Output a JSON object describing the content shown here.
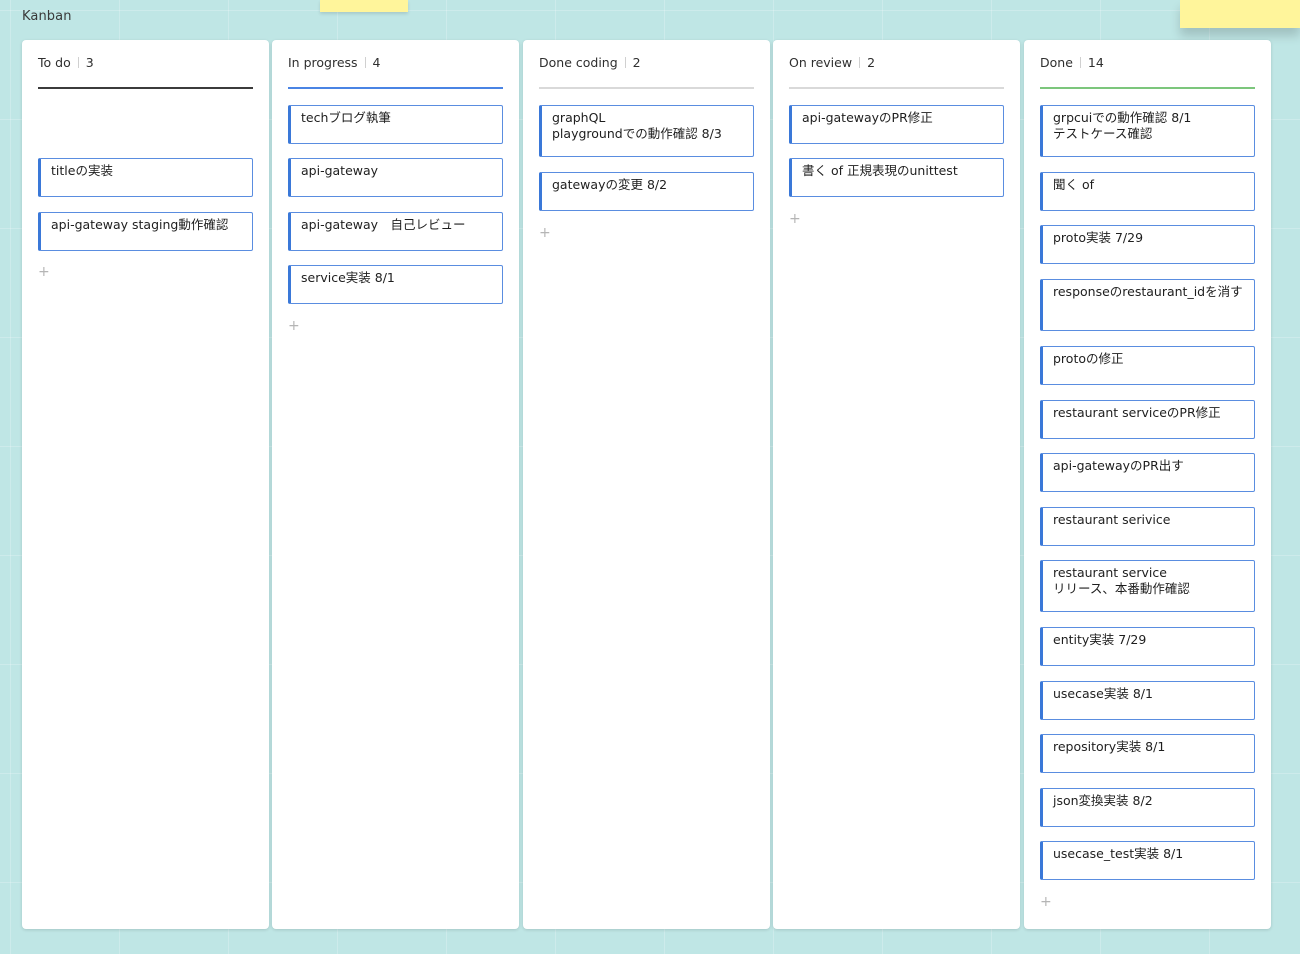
{
  "board": {
    "title": "Kanban"
  },
  "colors": {
    "background": "#bfe6e5",
    "card_border": "#3a78d8",
    "sticky_note": "#fff59b"
  },
  "columns": [
    {
      "title": "To do",
      "count": "3",
      "rule_color": "#3b3b3b",
      "cards": [
        "titleの実装",
        "api-gateway staging動作確認"
      ]
    },
    {
      "title": "In progress",
      "count": "4",
      "rule_color": "#4a84e4",
      "cards": [
        "techブログ執筆",
        "api-gateway",
        "api-gateway　自己レビュー",
        "service実装 8/1"
      ]
    },
    {
      "title": "Done coding",
      "count": "2",
      "rule_color": "#d9d9d9",
      "cards": [
        "graphQL\nplaygroundでの動作確認 8/3",
        "gatewayの変更 8/2"
      ]
    },
    {
      "title": "On review",
      "count": "2",
      "rule_color": "#d9d9d9",
      "cards": [
        "api-gatewayのPR修正",
        "書く of 正規表現のunittest"
      ]
    },
    {
      "title": "Done",
      "count": "14",
      "rule_color": "#7cc67c",
      "cards": [
        "grpcuiでの動作確認 8/1\nテストケース確認",
        "聞く of",
        "proto実装 7/29",
        "responseのrestaurant_idを消す",
        "protoの修正",
        "restaurant serviceのPR修正",
        "api-gatewayのPR出す",
        "restaurant serivice",
        "restaurant service\nリリース、本番動作確認",
        "entity実装 7/29",
        "usecase実装 8/1",
        "repository実装 8/1",
        "json変換実装 8/2",
        "usecase_test実装 8/1"
      ]
    }
  ],
  "add_card_label": "+"
}
